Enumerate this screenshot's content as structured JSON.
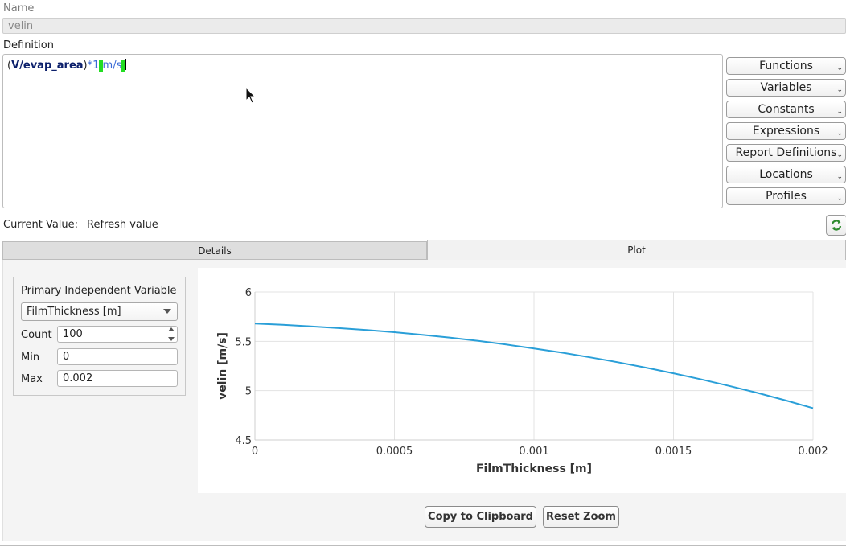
{
  "name_section": {
    "label": "Name",
    "value": "velin"
  },
  "definition_section": {
    "label": "Definition",
    "tokens": {
      "open_paren": "(",
      "variable": "V/evap_area",
      "close_paren": ")",
      "op": "*1",
      "unit_space": " ",
      "unit": "m/s",
      "trail": " "
    }
  },
  "side_buttons": [
    "Functions",
    "Variables",
    "Constants",
    "Expressions",
    "Report Definitions",
    "Locations",
    "Profiles"
  ],
  "current_value": {
    "label": "Current Value:",
    "value": "Refresh value",
    "refresh_icon": "refresh-icon"
  },
  "tabs": {
    "details": "Details",
    "plot": "Plot",
    "active": "Plot"
  },
  "plot_settings": {
    "group_title": "Primary Independent Variable",
    "variable": "FilmThickness [m]",
    "count_label": "Count",
    "count_value": "100",
    "min_label": "Min",
    "min_value": "0",
    "max_label": "Max",
    "max_value": "0.002"
  },
  "chart_data": {
    "type": "line",
    "xlabel": "FilmThickness [m]",
    "ylabel": "velin [m/s]",
    "xlim": [
      0,
      0.002
    ],
    "ylim": [
      4.5,
      6
    ],
    "x_ticks": [
      "0",
      "0.0005",
      "0.001",
      "0.0015",
      "0.002"
    ],
    "y_ticks": [
      "4.5",
      "5",
      "5.5",
      "6"
    ],
    "grid": true,
    "color": "#2a9fd8",
    "series": [
      {
        "x": [
          0,
          0.0001,
          0.0002,
          0.0003,
          0.0004,
          0.0005,
          0.0006,
          0.0007,
          0.0008,
          0.0009,
          0.001,
          0.0011,
          0.0012,
          0.0013,
          0.0014,
          0.0015,
          0.0016,
          0.0017,
          0.0018,
          0.0019,
          0.002
        ],
        "values": [
          5.68,
          5.667,
          5.652,
          5.634,
          5.614,
          5.592,
          5.566,
          5.537,
          5.504,
          5.468,
          5.428,
          5.385,
          5.338,
          5.288,
          5.234,
          5.176,
          5.114,
          5.048,
          4.978,
          4.903,
          4.823
        ]
      }
    ]
  },
  "bottom_buttons": {
    "copy": "Copy to Clipboard",
    "reset": "Reset Zoom"
  }
}
